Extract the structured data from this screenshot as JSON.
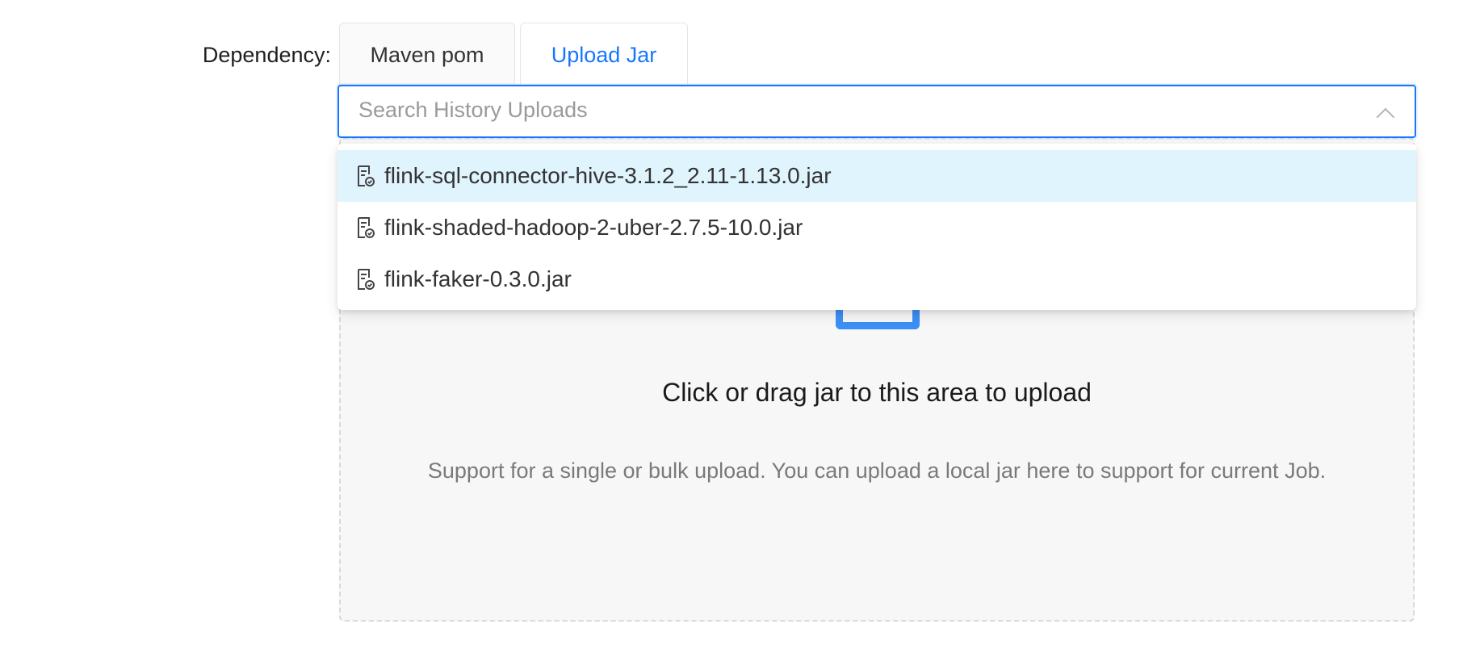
{
  "form": {
    "dependency_label": "Dependency:"
  },
  "tabs": [
    {
      "label": "Maven pom",
      "active": false
    },
    {
      "label": "Upload Jar",
      "active": true
    }
  ],
  "search": {
    "placeholder": "Search History Uploads",
    "icon": "chevron-up-icon"
  },
  "dropdown": {
    "options": [
      {
        "label": "flink-sql-connector-hive-3.1.2_2.11-1.13.0.jar",
        "icon": "file-check-icon",
        "highlighted": true
      },
      {
        "label": "flink-shaded-hadoop-2-uber-2.7.5-10.0.jar",
        "icon": "file-check-icon",
        "highlighted": false
      },
      {
        "label": "flink-faker-0.3.0.jar",
        "icon": "file-check-icon",
        "highlighted": false
      }
    ]
  },
  "upload": {
    "icon": "inbox-icon",
    "title": "Click or drag jar to this area to upload",
    "hint": "Support for a single or bulk upload. You can upload a local jar here to support for current Job."
  },
  "colors": {
    "accent": "#1677ff",
    "highlight": "#e0f4fd",
    "upload_icon": "#3b8ff5"
  }
}
